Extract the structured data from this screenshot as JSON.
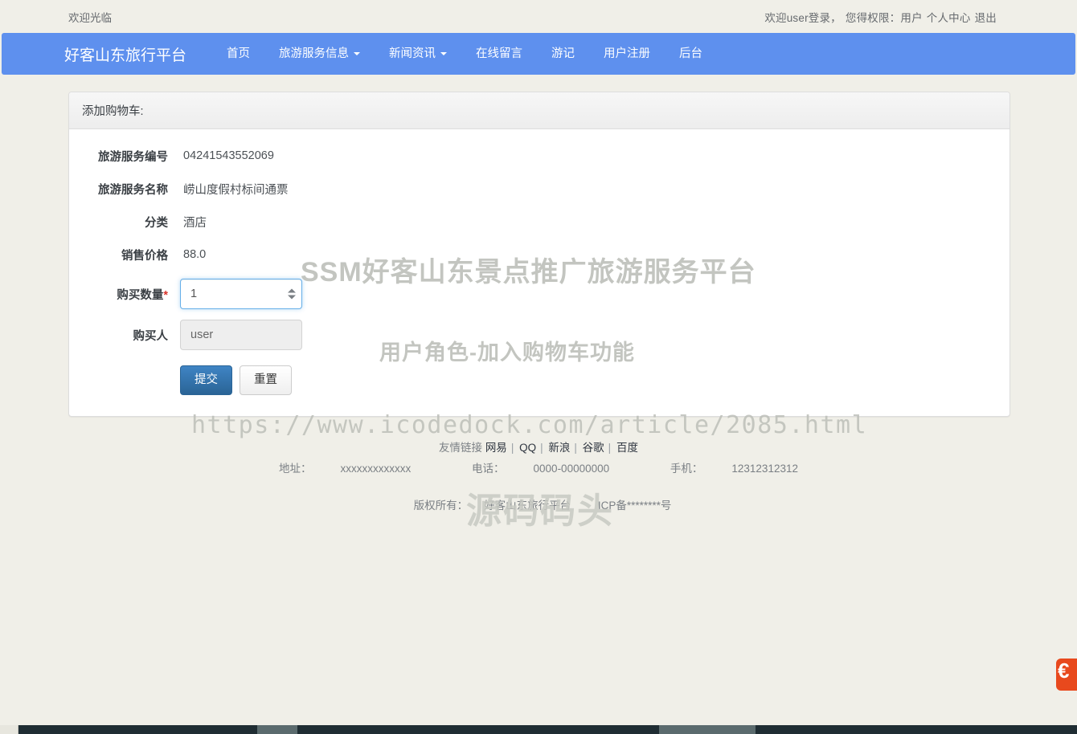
{
  "topbar": {
    "welcome": "欢迎光临",
    "login_prefix": "欢迎user登录，",
    "permission_label": "您得权限：",
    "permission_value": "用户",
    "profile_link": "个人中心",
    "logout_link": "退出"
  },
  "navbar": {
    "brand": "好客山东旅行平台",
    "items": [
      {
        "label": "首页",
        "caret": false
      },
      {
        "label": "旅游服务信息",
        "caret": true
      },
      {
        "label": "新闻资讯",
        "caret": true
      },
      {
        "label": "在线留言",
        "caret": false
      },
      {
        "label": "游记",
        "caret": false
      },
      {
        "label": "用户注册",
        "caret": false
      },
      {
        "label": "后台",
        "caret": false
      }
    ],
    "accent_color": "#5e90ee"
  },
  "panel": {
    "heading": "添加购物车:",
    "fields": [
      {
        "label": "旅游服务编号",
        "value": "04241543552069"
      },
      {
        "label": "旅游服务名称",
        "value": "崂山度假村标间通票"
      },
      {
        "label": "分类",
        "value": "酒店"
      },
      {
        "label": "销售价格",
        "value": "88.0"
      }
    ],
    "quantity": {
      "label": "购买数量",
      "required_mark": "*",
      "value": "1",
      "placeholder": ""
    },
    "buyer": {
      "label": "购买人",
      "value": "user",
      "placeholder": ""
    },
    "submit_label": "提交",
    "reset_label": "重置"
  },
  "footer": {
    "friend_links_label": "友情链接",
    "links": [
      "网易",
      "QQ",
      "新浪",
      "谷歌",
      "百度"
    ],
    "address_label": "地址：",
    "address_value": "xxxxxxxxxxxxx",
    "phone_label": "电话：",
    "phone_value": "0000-00000000",
    "mobile_label": "手机：",
    "mobile_value": "12312312312",
    "copyright_label": "版权所有：",
    "copyright_value": "好客山东旅行平台",
    "icp": "ICP备********号"
  },
  "watermarks": {
    "title": "SSM好客山东景点推广旅游服务平台",
    "subtitle": "用户角色-加入购物车功能",
    "url": "https://www.icodedock.com/article/2085.html",
    "brand": "源码码头"
  },
  "side_widget": {
    "glyph": "€"
  }
}
